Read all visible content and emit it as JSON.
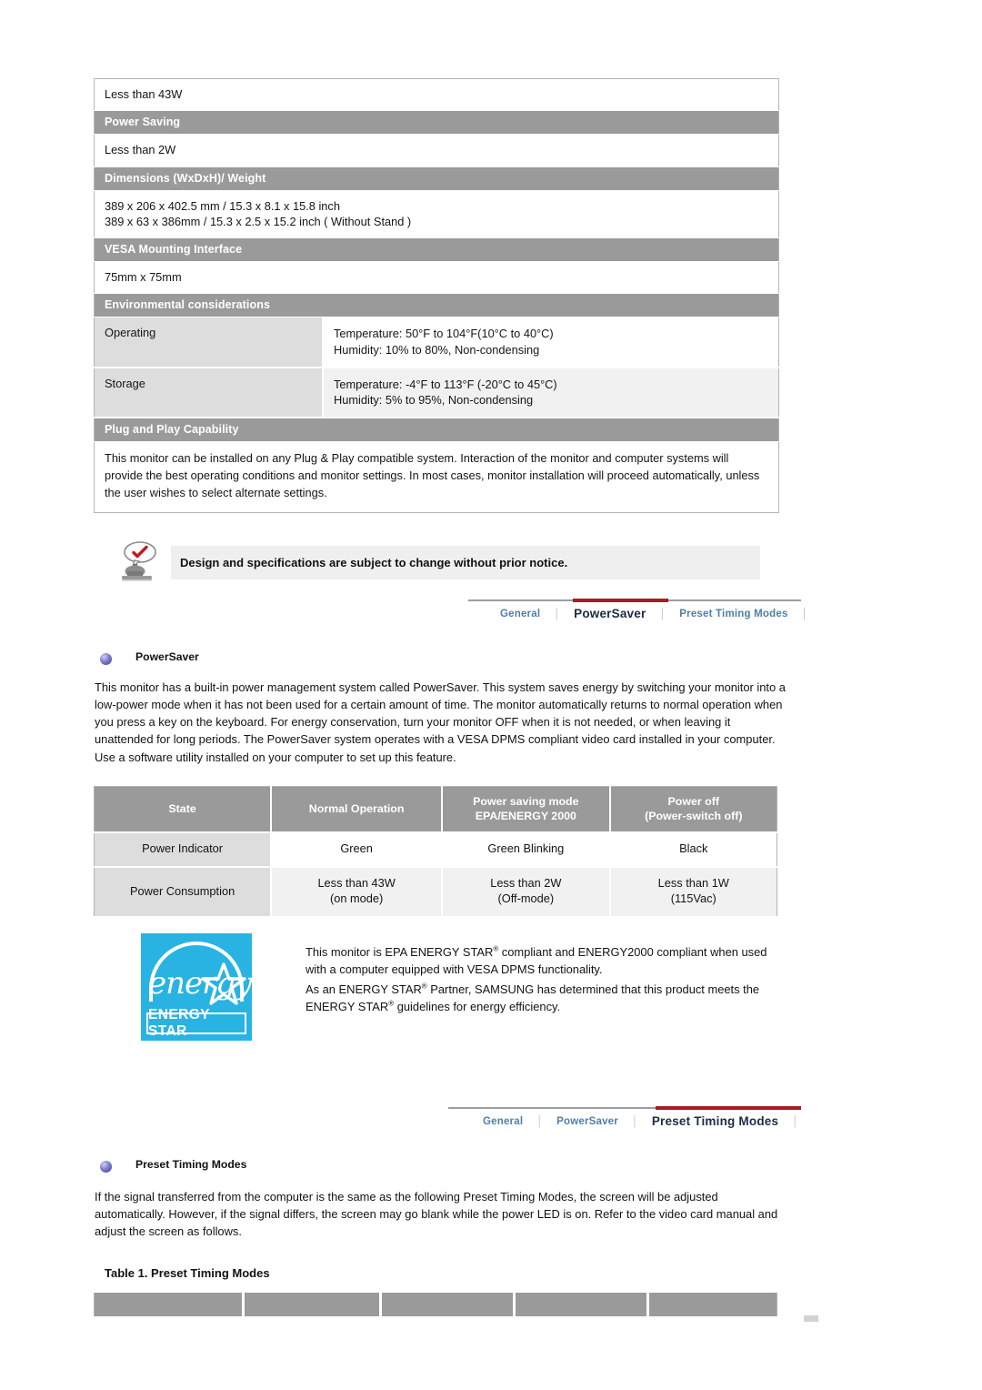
{
  "spec_table": {
    "rows": [
      {
        "kind": "value",
        "lines": [
          "Less than 43W"
        ]
      },
      {
        "kind": "header",
        "label": "Power Saving"
      },
      {
        "kind": "value",
        "lines": [
          "Less than 2W"
        ]
      },
      {
        "kind": "header",
        "label": "Dimensions (WxDxH)/ Weight"
      },
      {
        "kind": "value",
        "lines": [
          "389 x 206 x 402.5 mm / 15.3 x 8.1 x 15.8 inch",
          "389 x 63 x 386mm / 15.3 x 2.5 x 15.2 inch ( Without Stand )"
        ]
      },
      {
        "kind": "header",
        "label": "VESA Mounting Interface"
      },
      {
        "kind": "value",
        "lines": [
          "75mm x 75mm"
        ]
      },
      {
        "kind": "header",
        "label": "Environmental considerations"
      }
    ],
    "env_rows": [
      {
        "label": "Operating",
        "lines": [
          "Temperature: 50°F to 104°F(10°C to 40°C)",
          "Humidity: 10% to 80%, Non-condensing"
        ]
      },
      {
        "label": "Storage",
        "lines": [
          "Temperature: -4°F to 113°F (-20°C to 45°C)",
          "Humidity: 5% to 95%, Non-condensing"
        ]
      }
    ],
    "plug_header": "Plug and Play Capability",
    "plug_text": "This monitor can be installed on any Plug & Play compatible system. Interaction of the monitor and computer systems will provide the best operating conditions and monitor settings. In most cases, monitor installation will proceed automatically, unless the user wishes to select alternate settings."
  },
  "notice": {
    "icon": "monitor-check-icon",
    "text": "Design and specifications are subject to change without prior notice."
  },
  "nav_powersaver": {
    "tabs": [
      {
        "label": "General",
        "active": false
      },
      {
        "label": "PowerSaver",
        "active": true
      },
      {
        "label": "Preset Timing Modes",
        "active": false
      }
    ],
    "separator": "│",
    "accent_color": "#a61c24",
    "rule_color": "#9a9ea6",
    "link_color": "#4f7fa8",
    "active_color": "#1d2b44"
  },
  "nav_preset": {
    "tabs": [
      {
        "label": "General",
        "active": false
      },
      {
        "label": "PowerSaver",
        "active": false
      },
      {
        "label": "Preset Timing Modes",
        "active": true
      }
    ],
    "separator": "│"
  },
  "powersaver_section": {
    "bullet_icon": "sphere-bullet-icon",
    "heading": "PowerSaver",
    "paragraph": "This monitor has a built-in power management system called PowerSaver. This system saves energy by switching your monitor into a low-power mode when it has not been used for a certain amount of time. The monitor automatically returns to normal operation when you press a key on the keyboard. For energy conservation, turn your monitor OFF when it is not needed, or when leaving it unattended for long periods. The PowerSaver system operates with a VESA DPMS compliant video card installed in your computer. Use a software utility installed on your computer to set up this feature."
  },
  "powersaver_table": {
    "headers": [
      {
        "line1": "State",
        "line2": ""
      },
      {
        "line1": "Normal Operation",
        "line2": ""
      },
      {
        "line1": "Power saving mode",
        "line2": "EPA/ENERGY 2000"
      },
      {
        "line1": "Power off",
        "line2": "(Power-switch off)"
      }
    ],
    "rows": [
      {
        "label": "Power Indicator",
        "cells": [
          {
            "line1": "Green",
            "line2": ""
          },
          {
            "line1": "Green Blinking",
            "line2": ""
          },
          {
            "line1": "Black",
            "line2": ""
          }
        ]
      },
      {
        "label": "Power Consumption",
        "cells": [
          {
            "line1": "Less than 43W",
            "line2": "(on mode)"
          },
          {
            "line1": "Less than 2W",
            "line2": "(Off-mode)"
          },
          {
            "line1": "Less than 1W",
            "line2": "(115Vac)"
          }
        ]
      }
    ]
  },
  "energy_star": {
    "logo_word": "energy",
    "logo_band": "ENERGY STAR",
    "logo_color": "#29b3e3",
    "paragraph1_a": "This monitor is EPA ENERGY STAR",
    "paragraph1_b": " compliant and ENERGY2000 compliant when used with a computer equipped with VESA DPMS functionality.",
    "paragraph2_a": "As an ENERGY STAR",
    "paragraph2_b": " Partner, SAMSUNG has determined that this product meets the ENERGY STAR",
    "paragraph2_c": " guidelines for energy efficiency.",
    "reg_mark": "®"
  },
  "preset_section": {
    "bullet_icon": "sphere-bullet-icon",
    "heading": "Preset Timing Modes",
    "paragraph": "If the signal transferred from the computer is the same as the following Preset Timing Modes, the screen will be adjusted automatically. However, if the signal differs, the screen may go blank while the power LED is on. Refer to the video card manual and adjust the screen as follows.",
    "table_caption": "Table 1. Preset Timing Modes",
    "table_columns": [
      "",
      "",
      "",
      "",
      ""
    ]
  }
}
